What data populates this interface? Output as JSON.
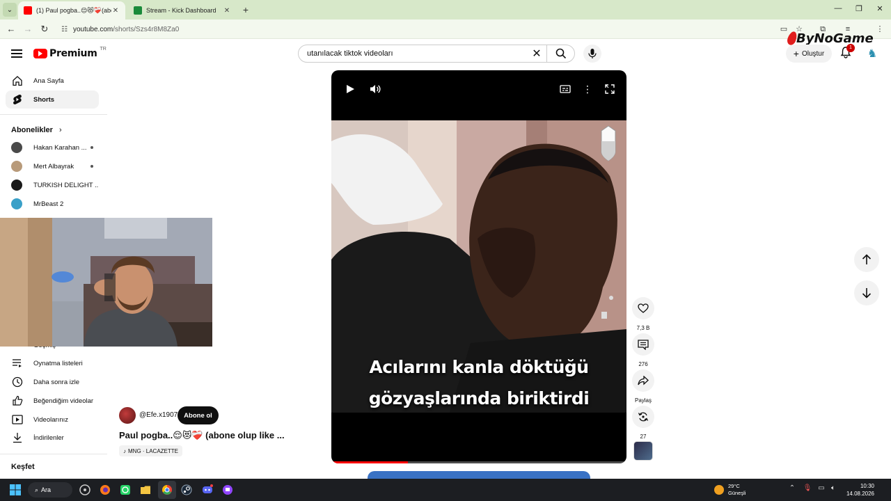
{
  "browser": {
    "tabs": [
      {
        "title": "(1) Paul pogba..😌😻❤️‍🩹(abone",
        "active": true
      },
      {
        "title": "Stream - Kick Dashboard",
        "active": false
      }
    ],
    "url_domain": "youtube.com",
    "url_path": "/shorts/Szs4r8M8Za0"
  },
  "watermark": "ByNoGame",
  "youtube": {
    "brand": "Premium",
    "country": "TR",
    "search_query": "utanılacak tiktok videoları",
    "create_label": "Oluştur",
    "notification_count": "1"
  },
  "sidebar": {
    "main": [
      {
        "label": "Ana Sayfa",
        "icon": "home-icon"
      },
      {
        "label": "Shorts",
        "icon": "shorts-icon",
        "active": true
      }
    ],
    "subscriptions_header": "Abonelikler",
    "subscriptions": [
      {
        "name": "Hakan Karahan ...",
        "color": "#4a4a4a"
      },
      {
        "name": "Mert Albayrak",
        "color": "#b89a7a"
      },
      {
        "name": "TURKISH DELIGHT ...",
        "color": "#1a1a1a"
      },
      {
        "name": "MrBeast 2",
        "color": "#3aa0c8"
      }
    ],
    "library_partial": "Geçmiş",
    "library": [
      {
        "label": "Oynatma listeleri",
        "icon": "playlist-icon"
      },
      {
        "label": "Daha sonra izle",
        "icon": "clock-icon"
      },
      {
        "label": "Beğendiğim videolar",
        "icon": "like-icon"
      },
      {
        "label": "Videolarınız",
        "icon": "video-icon"
      },
      {
        "label": "İndirilenler",
        "icon": "download-icon"
      }
    ],
    "explore_header": "Keşfet"
  },
  "short": {
    "caption_line1": "Acılarını kanla döktüğü",
    "caption_line2": "gözyaşlarında biriktirdi",
    "progress": 0.26,
    "channel": "@Efe.x1907",
    "subscribe_label": "Abone ol",
    "title": "Paul pogba..😌😻❤️‍🩹 (abone olup like ...",
    "music": "MNG · LACAZETTE",
    "likes": "7,3 B",
    "comments": "276",
    "share_label": "Paylaş",
    "remix_count": "27"
  },
  "taskbar": {
    "search_label": "Ara",
    "temperature": "29°C",
    "weather": "Güneşli",
    "time": "10:30",
    "date": "14.08.2026"
  }
}
